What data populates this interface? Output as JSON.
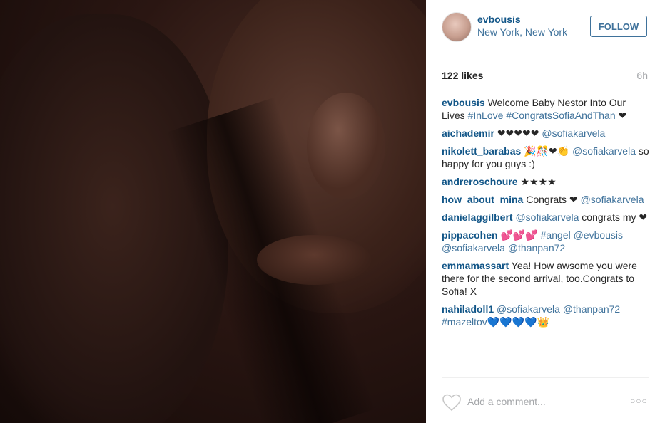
{
  "post": {
    "username": "evbousis",
    "location": "New York, New York",
    "follow_label": "FOLLOW",
    "likes": "122 likes",
    "time": "6h"
  },
  "comments": [
    {
      "user": "evbousis",
      "parts": [
        {
          "t": "text",
          "v": " Welcome Baby Nestor Into Our Lives "
        },
        {
          "t": "link",
          "v": "#InLove"
        },
        {
          "t": "text",
          "v": " "
        },
        {
          "t": "link",
          "v": "#CongratsSofiaAndThan"
        },
        {
          "t": "text",
          "v": " ❤"
        }
      ]
    },
    {
      "user": "aichademir",
      "parts": [
        {
          "t": "text",
          "v": " ❤❤❤❤❤ "
        },
        {
          "t": "link",
          "v": "@sofiakarvela"
        }
      ]
    },
    {
      "user": "nikolett_barabas",
      "parts": [
        {
          "t": "text",
          "v": " 🎉🎊❤👏 "
        },
        {
          "t": "link",
          "v": "@sofiakarvela"
        },
        {
          "t": "text",
          "v": " so happy for you guys :)"
        }
      ]
    },
    {
      "user": "andreroschoure",
      "parts": [
        {
          "t": "text",
          "v": " ★★★★"
        }
      ]
    },
    {
      "user": "how_about_mina",
      "parts": [
        {
          "t": "text",
          "v": " Congrats ❤ "
        },
        {
          "t": "link",
          "v": "@sofiakarvela"
        }
      ]
    },
    {
      "user": "danielaggilbert",
      "parts": [
        {
          "t": "text",
          "v": " "
        },
        {
          "t": "link",
          "v": "@sofiakarvela"
        },
        {
          "t": "text",
          "v": " congrats my ❤"
        }
      ]
    },
    {
      "user": "pippacohen",
      "parts": [
        {
          "t": "text",
          "v": " 💕💕💕 "
        },
        {
          "t": "link",
          "v": "#angel"
        },
        {
          "t": "text",
          "v": " "
        },
        {
          "t": "link",
          "v": "@evbousis"
        },
        {
          "t": "text",
          "v": " "
        },
        {
          "t": "link",
          "v": "@sofiakarvela"
        },
        {
          "t": "text",
          "v": " "
        },
        {
          "t": "link",
          "v": "@thanpan72"
        }
      ]
    },
    {
      "user": "emmamassart",
      "parts": [
        {
          "t": "text",
          "v": " Yea! How awsome you were there for the second arrival, too.Congrats to Sofia! X"
        }
      ]
    },
    {
      "user": "nahiladoll1",
      "parts": [
        {
          "t": "text",
          "v": " "
        },
        {
          "t": "link",
          "v": "@sofiakarvela"
        },
        {
          "t": "text",
          "v": " "
        },
        {
          "t": "link",
          "v": "@thanpan72"
        },
        {
          "t": "text",
          "v": " "
        },
        {
          "t": "link",
          "v": "#mazeltov"
        },
        {
          "t": "link",
          "v": "💙💙💙💙👑"
        }
      ]
    }
  ],
  "composer": {
    "placeholder": "Add a comment...",
    "more_label": "○○○"
  },
  "colors": {
    "username": "#125688",
    "link": "#3f729b",
    "muted": "#a5a7aa"
  },
  "icons": {
    "like": "heart-outline-icon",
    "more": "ellipsis-icon"
  }
}
